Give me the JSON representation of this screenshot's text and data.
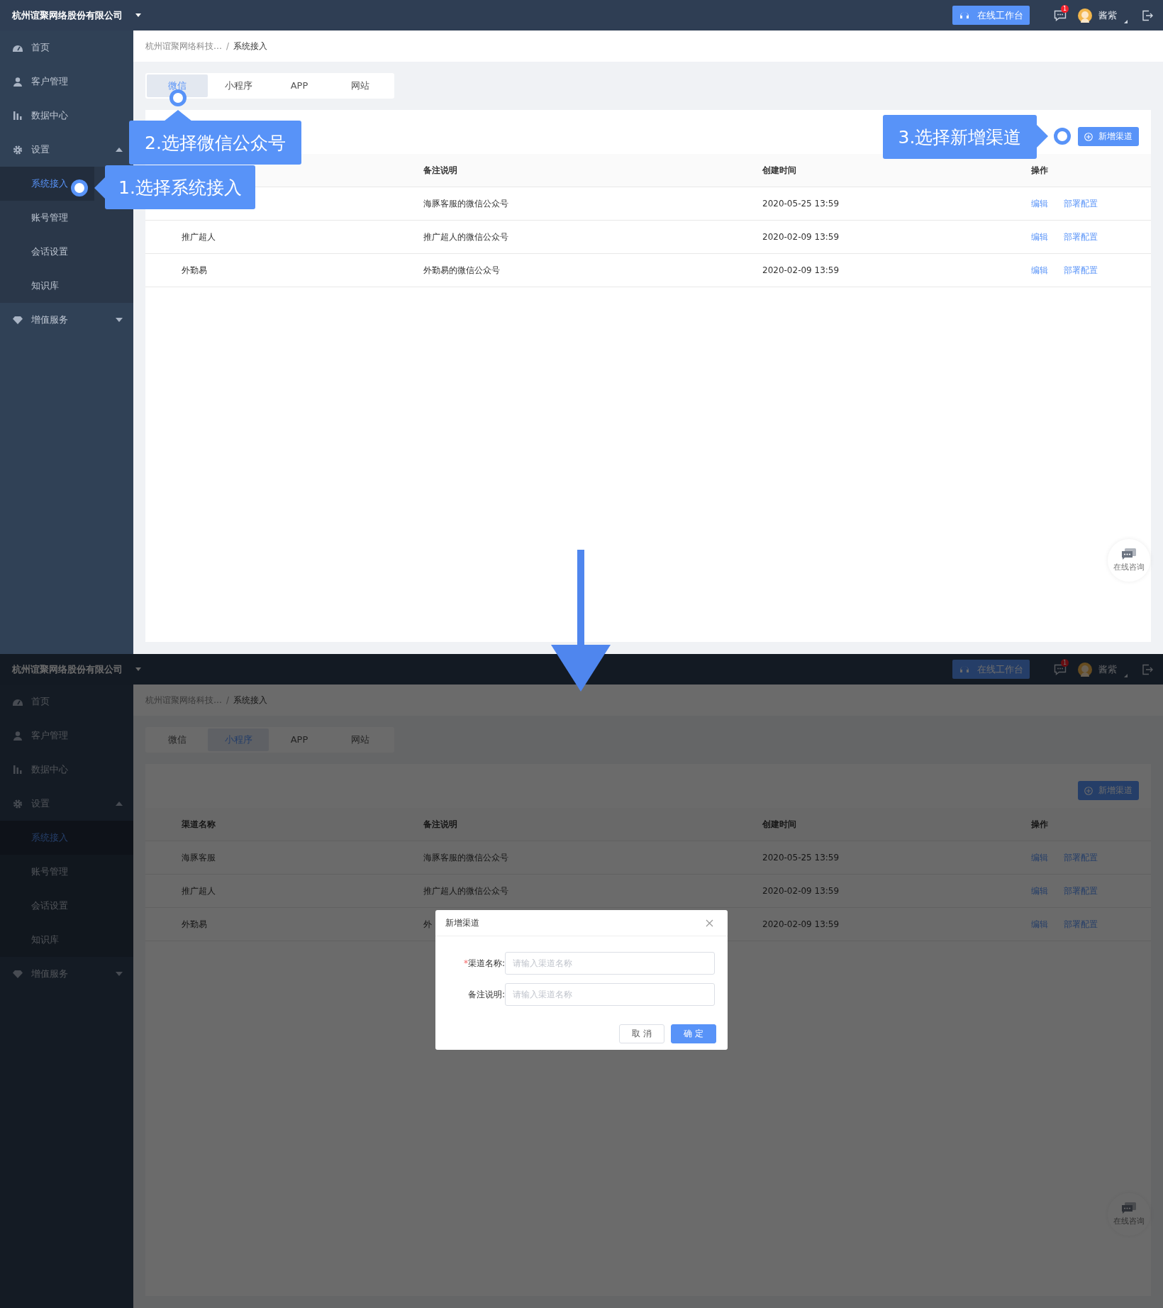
{
  "screens": [
    {
      "dimmed": false,
      "topbar": {
        "company": "杭州谊聚网络股份有限公司",
        "workbench_button": "在线工作台",
        "message_badge": "1",
        "user_name": "酱紫"
      },
      "sidebar": {
        "items": [
          {
            "label": "首页"
          },
          {
            "label": "客户管理"
          },
          {
            "label": "数据中心"
          },
          {
            "label": "设置",
            "expanded": true,
            "children": [
              {
                "label": "系统接入",
                "selected": true
              },
              {
                "label": "账号管理",
                "selected": false
              },
              {
                "label": "会话设置",
                "selected": false
              },
              {
                "label": "知识库",
                "selected": false
              }
            ]
          },
          {
            "label": "增值服务",
            "expanded": false
          }
        ]
      },
      "breadcrumb": {
        "items": [
          "杭州谊聚网络科技…",
          "系统接入"
        ],
        "separator": "/"
      },
      "tabs": [
        {
          "label": "微信",
          "selected": true
        },
        {
          "label": "小程序",
          "selected": false
        },
        {
          "label": "APP",
          "selected": false
        },
        {
          "label": "网站",
          "selected": false
        }
      ],
      "add_button": "新增渠道",
      "table": {
        "columns": {
          "remark": "备注说明",
          "created": "创建时间",
          "actions": "操作"
        },
        "rows": [
          {
            "remark": "海豚客服的微信公众号",
            "created": "2020-05-25 13:59",
            "actions": [
              "编辑",
              "部署配置"
            ]
          },
          {
            "name": "推广超人",
            "remark": "推广超人的微信公众号",
            "created": "2020-02-09 13:59",
            "actions": [
              "编辑",
              "部署配置"
            ]
          },
          {
            "name": "外勤易",
            "remark": "外勤易的微信公众号",
            "created": "2020-02-09 13:59",
            "actions": [
              "编辑",
              "部署配置"
            ]
          }
        ]
      },
      "consult_widget": "在线咨询",
      "annotations": [
        {
          "text": "2.选择微信公众号"
        },
        {
          "text": "3.选择新增渠道"
        },
        {
          "text": "1.选择系统接入"
        }
      ]
    },
    {
      "dimmed": true,
      "topbar": {
        "company": "杭州谊聚网络股份有限公司",
        "workbench_button": "在线工作台",
        "message_badge": "1",
        "user_name": "酱紫"
      },
      "sidebar": {
        "items": [
          {
            "label": "首页"
          },
          {
            "label": "客户管理"
          },
          {
            "label": "数据中心"
          },
          {
            "label": "设置",
            "expanded": true,
            "children": [
              {
                "label": "系统接入",
                "selected": true
              },
              {
                "label": "账号管理",
                "selected": false
              },
              {
                "label": "会话设置",
                "selected": false
              },
              {
                "label": "知识库",
                "selected": false
              }
            ]
          },
          {
            "label": "增值服务",
            "expanded": false
          }
        ]
      },
      "breadcrumb": {
        "items": [
          "杭州谊聚网络科技…",
          "系统接入"
        ],
        "separator": "/"
      },
      "tabs": [
        {
          "label": "微信",
          "selected": false
        },
        {
          "label": "小程序",
          "selected": true
        },
        {
          "label": "APP",
          "selected": false
        },
        {
          "label": "网站",
          "selected": false
        }
      ],
      "add_button": "新增渠道",
      "table": {
        "columns": {
          "name": "渠道名称",
          "remark": "备注说明",
          "created": "创建时间",
          "actions": "操作"
        },
        "rows": [
          {
            "name": "海豚客服",
            "remark": "海豚客服的微信公众号",
            "created": "2020-05-25 13:59",
            "actions": [
              "编辑",
              "部署配置"
            ]
          },
          {
            "name": "推广超人",
            "remark": "推广超人的微信公众号",
            "created": "2020-02-09 13:59",
            "actions": [
              "编辑",
              "部署配置"
            ]
          },
          {
            "name": "外勤易",
            "remark": "外",
            "created": "2020-02-09 13:59",
            "actions": [
              "编辑",
              "部署配置"
            ]
          }
        ]
      },
      "consult_widget": "在线咨询",
      "dialog": {
        "title": "新增渠道",
        "fields": [
          {
            "required_mark": "*",
            "label": "渠道名称:",
            "placeholder": "请输入渠道名称"
          },
          {
            "label": "备注说明:",
            "placeholder": "请输入渠道名称"
          }
        ],
        "buttons": [
          {
            "label": "取 消",
            "kind": "default"
          },
          {
            "label": "确 定",
            "kind": "primary"
          }
        ]
      }
    }
  ]
}
